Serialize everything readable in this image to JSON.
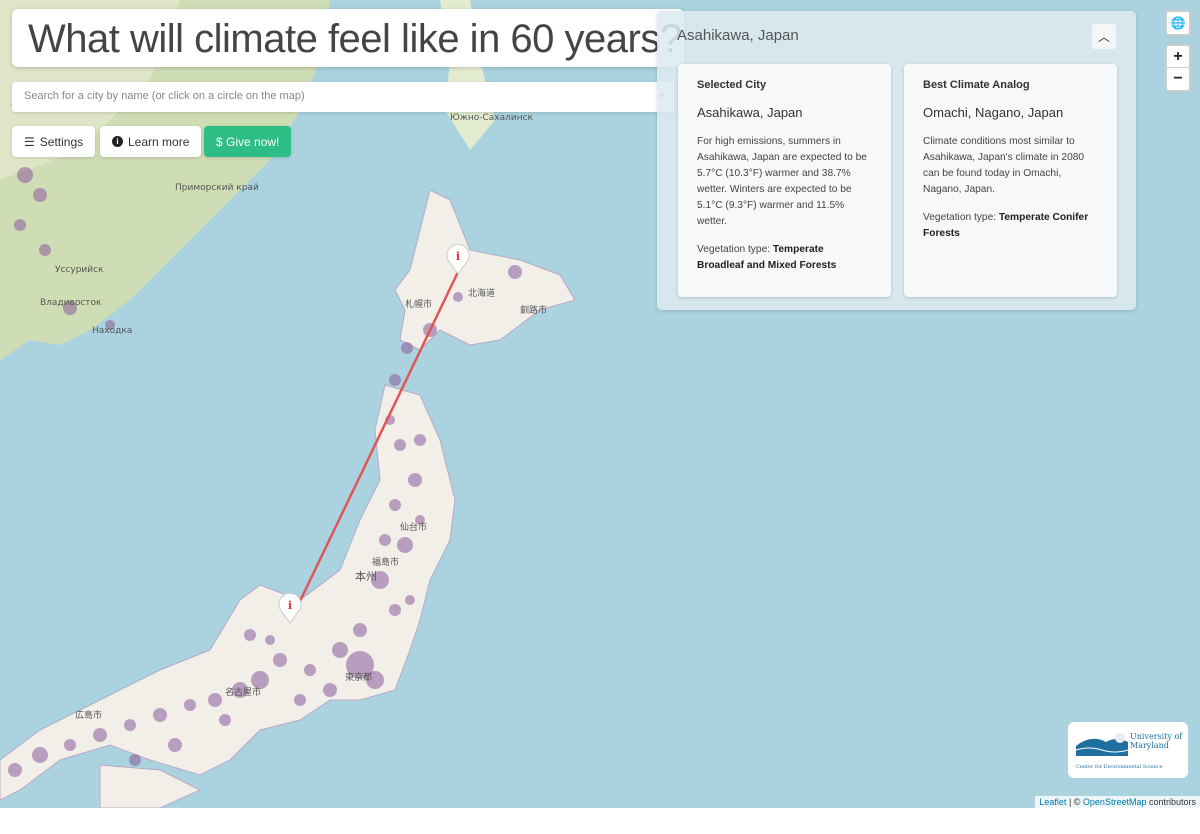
{
  "header": {
    "title": "What will climate feel like in 60 years?"
  },
  "search": {
    "placeholder": "Search for a city by name (or click on a circle on the map)"
  },
  "buttons": {
    "settings": "Settings",
    "learn_more": "Learn more",
    "give_now": "$ Give now!"
  },
  "panel": {
    "title": "Asahikawa, Japan",
    "selected": {
      "heading": "Selected City",
      "city": "Asahikawa, Japan",
      "description": "For high emissions, summers in Asahikawa, Japan are expected to be 5.7°C (10.3°F) warmer and 38.7% wetter. Winters are expected to be 5.1°C (9.3°F) warmer and 11.5% wetter.",
      "veg_label": "Vegetation type: ",
      "veg_value": "Temperate Broadleaf and Mixed Forests"
    },
    "analog": {
      "heading": "Best Climate Analog",
      "city": "Omachi, Nagano, Japan",
      "description": "Climate conditions most similar to Asahikawa, Japan's climate in 2080 can be found today in Omachi, Nagano, Japan.",
      "veg_label": "Vegetation type: ",
      "veg_value": "Temperate Conifer Forests"
    }
  },
  "map_controls": {
    "zoom_in": "+",
    "zoom_out": "−"
  },
  "map_labels": {
    "sakhalin": "Южно-Сахалинск",
    "vladivostok": "Владивосток",
    "nakhodka": "Находка",
    "ussuriysk": "Уссурийск",
    "primorsky": "Приморский край",
    "hokkaido": "北海道",
    "sapporo": "札幌市",
    "kushiro": "釧路市",
    "honshu": "本州",
    "fukushima": "福島市",
    "tokyo": "東京都",
    "nagoya": "名古屋市",
    "hiroshima": "広島市",
    "sendai": "仙台市"
  },
  "logo": {
    "line1": "University of Maryland",
    "line2": "Center for Environmental Science"
  },
  "attribution": {
    "leaflet": "Leaflet",
    "sep": " | © ",
    "osm": "OpenStreetMap",
    "contributors": " contributors"
  },
  "colors": {
    "sea": "#aad3df",
    "land": "#f2efe9",
    "accent_green": "#2ebd85",
    "route_line": "#e05555",
    "city_circle": "#8a5a9a"
  }
}
